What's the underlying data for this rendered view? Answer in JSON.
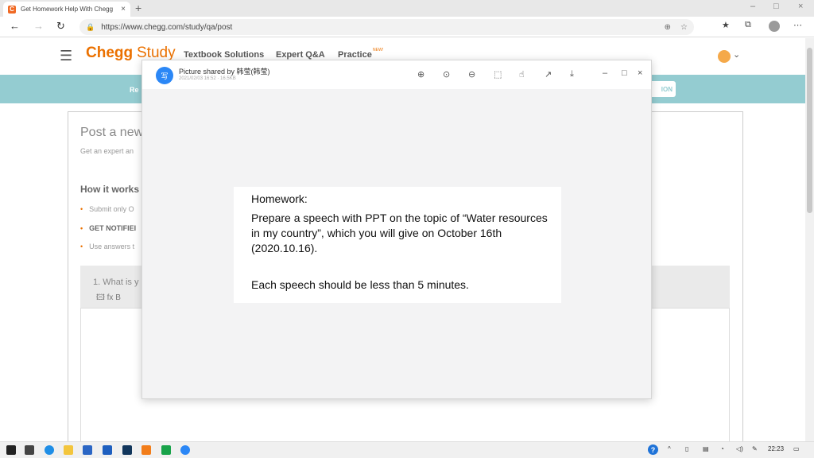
{
  "browser": {
    "tab_title": "Get Homework Help With Chegg",
    "tab_favicon": "C",
    "tab_close": "×",
    "new_tab": "+",
    "url": "https://www.chegg.com/study/qa/post",
    "back_icon": "←",
    "forward_icon": "→",
    "reload_icon": "↻",
    "lock_icon": "🔒",
    "zoom_icon": "⊕",
    "fav_icon": "☆",
    "collections_icon": "★",
    "menu_icon": "⋯",
    "minimize": "–",
    "maximize": "□",
    "close": "×"
  },
  "chegg": {
    "hamburger": "☰",
    "logo_chegg": "Chegg",
    "logo_study": "Study",
    "nav": [
      "Textbook Solutions",
      "Expert Q&A",
      "Practice"
    ],
    "new_badge": "NEW!",
    "avatar_chevron": "⌄",
    "teal_left": "Re",
    "teal_right": "ION",
    "post_title": "Post a new",
    "post_sub": "Get an expert an",
    "how_it_works": "How it works",
    "bullets": [
      "Submit only O",
      "GET NOTIFIEI",
      "Use answers t"
    ],
    "question_label": "1. What is y",
    "question_tools": "🖾  fx  B"
  },
  "viewer": {
    "icon_text": "写",
    "title": "Picture shared by 韩莹(韩莹)",
    "meta": "2021/02/03 16:52 · 16.5KB",
    "tools": {
      "zoom_in": "⊕",
      "actual_size": "⊙",
      "zoom_out": "⊖",
      "rotate": "⬚",
      "hand": "☝",
      "share": "↗",
      "download": "⤓"
    },
    "minimize": "–",
    "maximize": "□",
    "close": "×",
    "doc": {
      "heading": "Homework:",
      "body": "Prepare a speech with PPT on the topic of “Water resources in my country”, which you will give on October 16th (2020.10.16).",
      "note": "Each speech should be less than 5 minutes."
    }
  },
  "taskbar": {
    "help": "?",
    "chevron_up": "^",
    "time": "22:23",
    "notification_icon": "▭"
  }
}
